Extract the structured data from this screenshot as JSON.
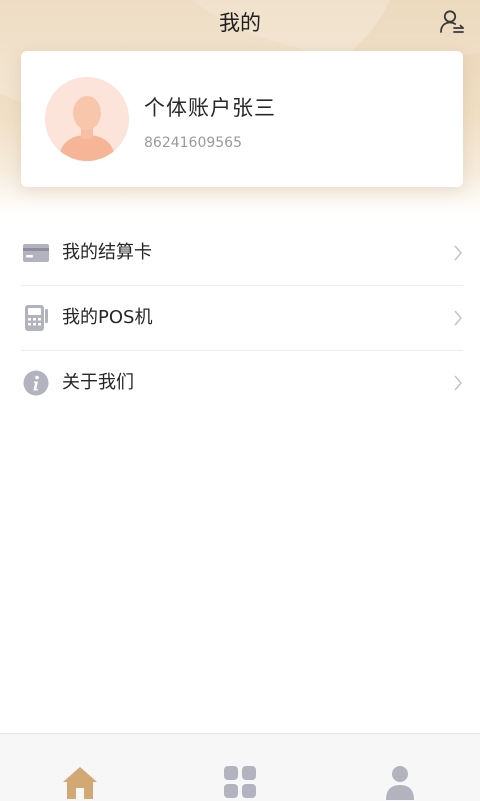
{
  "header": {
    "title": "我的",
    "switch_icon": "switch-account-icon"
  },
  "profile": {
    "name": "个体账户张三",
    "account_id": "86241609565",
    "avatar_icon": "user-avatar-icon"
  },
  "menu": {
    "items": [
      {
        "label": "我的结算卡",
        "icon": "bank-card-icon"
      },
      {
        "label": "我的POS机",
        "icon": "pos-terminal-icon"
      },
      {
        "label": "关于我们",
        "icon": "info-icon"
      }
    ]
  },
  "tabbar": {
    "tabs": [
      {
        "icon": "home-icon",
        "active": true
      },
      {
        "icon": "apps-grid-icon",
        "active": false
      },
      {
        "icon": "person-icon",
        "active": false
      }
    ]
  },
  "colors": {
    "accent": "#d2a874",
    "header_bg": "#ead4b4",
    "icon_gray": "#b3b3bf",
    "text_dark": "#262626",
    "text_muted": "#9a9a9a"
  }
}
